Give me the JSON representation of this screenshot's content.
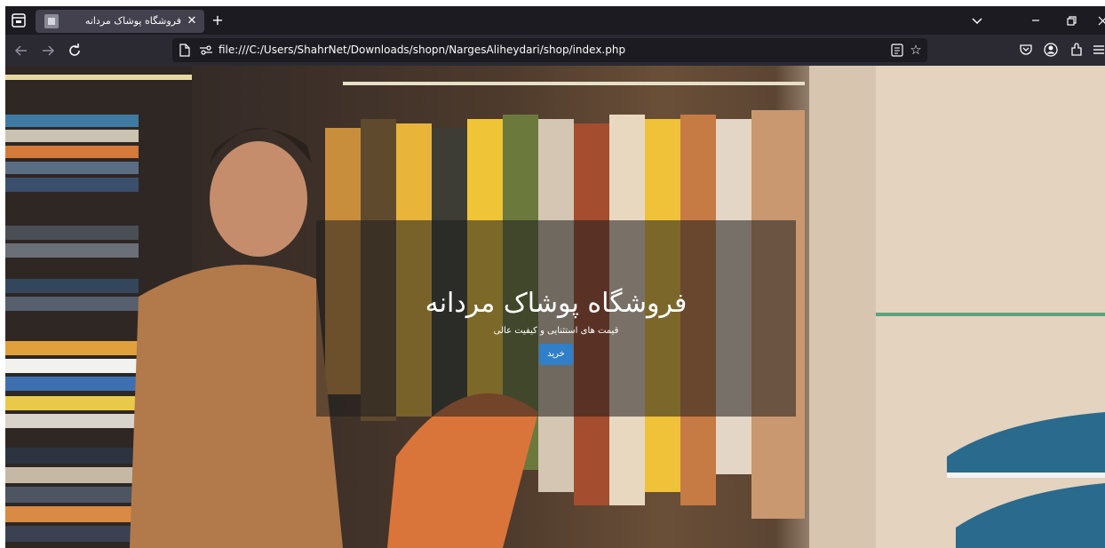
{
  "browser": {
    "tab": {
      "title": "فروشگاه پوشاک مردانه",
      "close_label": "✕"
    },
    "new_tab_label": "+",
    "address": {
      "url": "file:///C:/Users/ShahrNet/Downloads/shopn/NargesAliheydari/shop/index.php"
    },
    "icons": {
      "back": "arrow-left-icon",
      "forward": "arrow-right-icon",
      "reload": "reload-icon",
      "star": "bookmark-star-icon"
    }
  },
  "hero": {
    "title": "فروشگاه پوشاک مردانه",
    "subtitle": "قیمت های استثنایی و کیفیت عالی",
    "button_label": "خرید",
    "colors": {
      "overlay": "#1e1e1e",
      "button": "#2f7fc9",
      "text": "#ffffff"
    }
  },
  "chrome_colors": {
    "tabbar": "#1c1b22",
    "navbar": "#2b2a33",
    "tab_active": "#42414d"
  }
}
